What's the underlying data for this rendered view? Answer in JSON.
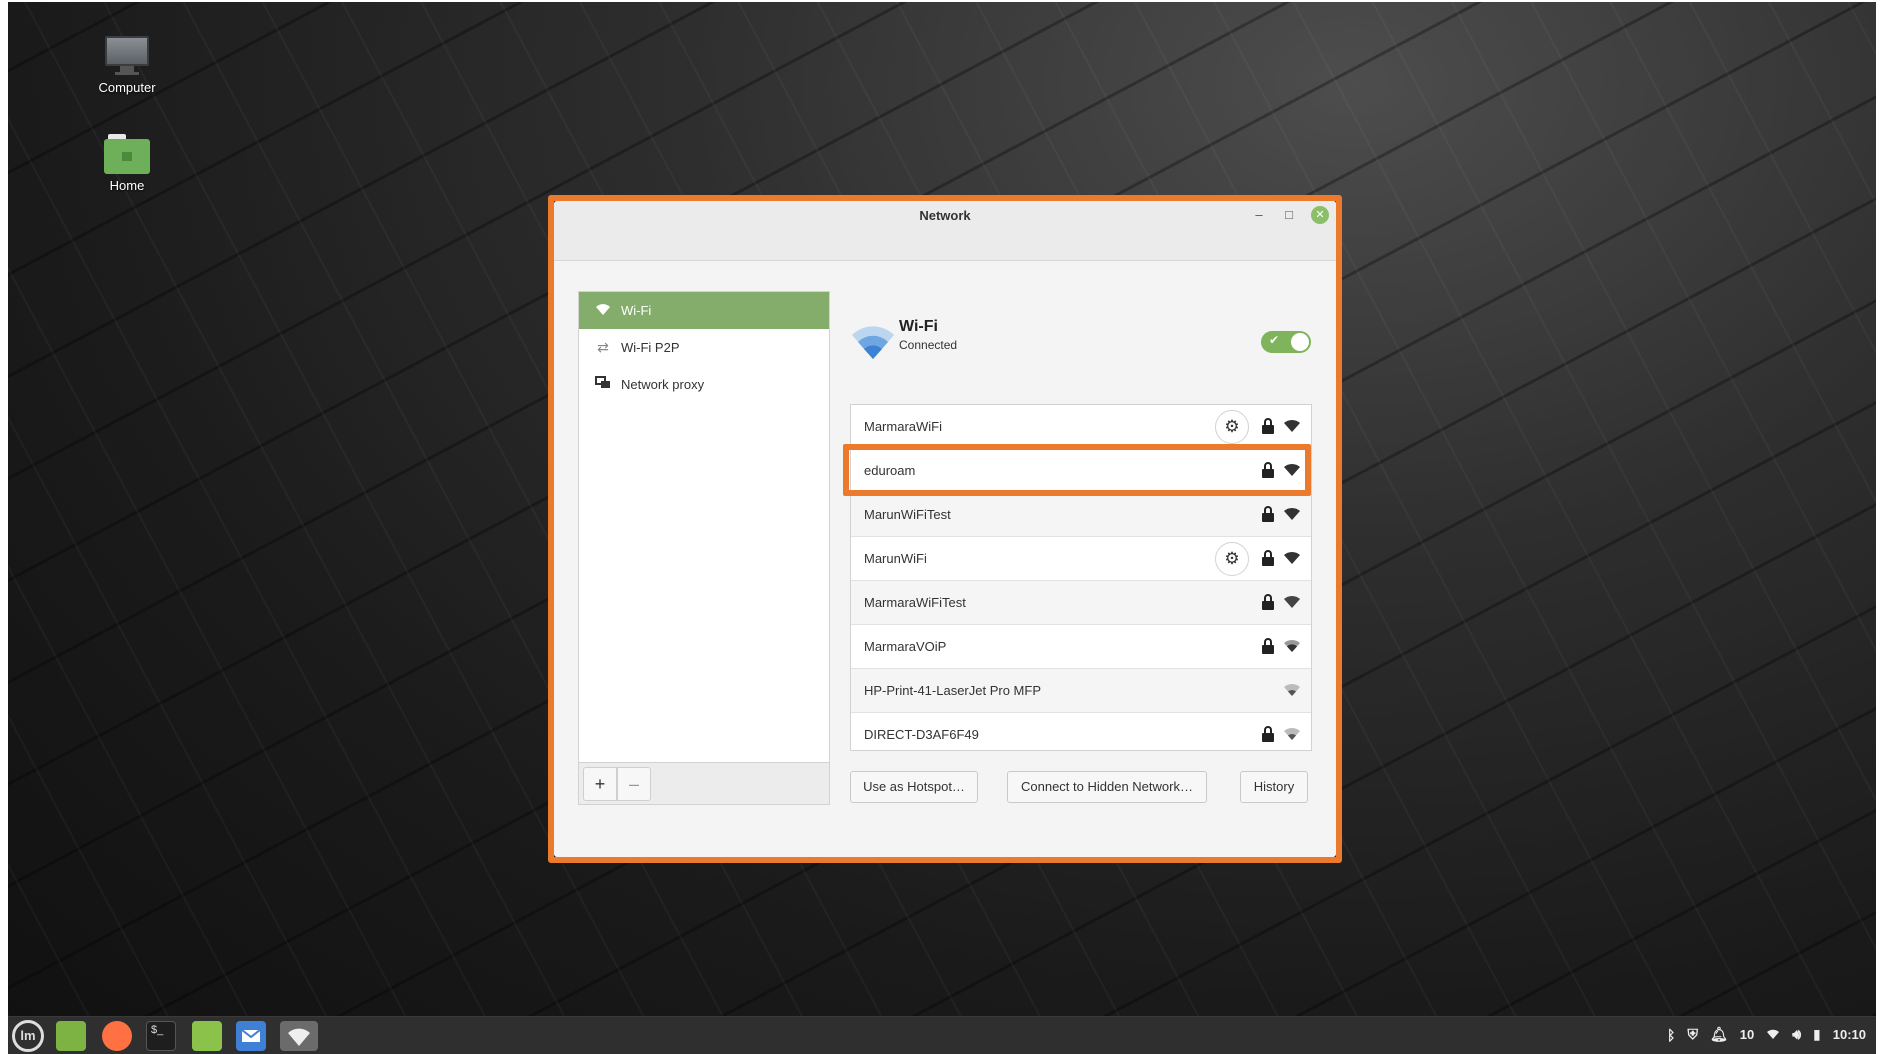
{
  "desktop": {
    "icons": [
      {
        "label": "Computer",
        "icon": "monitor-icon"
      },
      {
        "label": "Home",
        "icon": "folder-icon"
      }
    ]
  },
  "window": {
    "title": "Network",
    "controls": {
      "minimize": "–",
      "maximize": "□",
      "close": "✕"
    }
  },
  "sidebar": {
    "items": [
      {
        "label": "Wi-Fi",
        "icon": "wifi-icon",
        "selected": true
      },
      {
        "label": "Wi-Fi P2P",
        "icon": "p2p-arrows-icon",
        "selected": false
      },
      {
        "label": "Network proxy",
        "icon": "network-proxy-icon",
        "selected": false
      }
    ],
    "add_label": "+",
    "remove_label": "–"
  },
  "wifi": {
    "title": "Wi-Fi",
    "status": "Connected",
    "enabled": true
  },
  "networks": [
    {
      "name": "MarmaraWiFi",
      "settings": true,
      "locked": true
    },
    {
      "name": "eduroam",
      "settings": false,
      "locked": true
    },
    {
      "name": "MarunWiFiTest",
      "settings": false,
      "locked": true
    },
    {
      "name": "MarunWiFi",
      "settings": true,
      "locked": true
    },
    {
      "name": "MarmaraWiFiTest",
      "settings": false,
      "locked": true
    },
    {
      "name": "MarmaraVOiP",
      "settings": false,
      "locked": true
    },
    {
      "name": "HP-Print-41-LaserJet Pro MFP",
      "settings": false,
      "locked": false
    },
    {
      "name": "DIRECT-D3AF6F49",
      "settings": false,
      "locked": true
    }
  ],
  "actions": {
    "hotspot": "Use as Hotspot…",
    "hidden": "Connect to Hidden Network…",
    "history": "History"
  },
  "taskbar": {
    "menu_label": "lm",
    "terminal_label": "$_",
    "tray": {
      "notifications": "10",
      "clock": "10:10"
    }
  },
  "colors": {
    "highlight": "#ec7a2c",
    "accent": "#84ad6b",
    "toggle_on": "#7fb35c"
  }
}
